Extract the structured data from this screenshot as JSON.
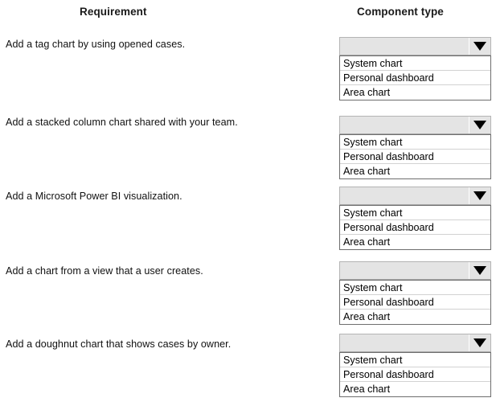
{
  "headers": {
    "requirement": "Requirement",
    "component_type": "Component type"
  },
  "dropdown_icon": "chevron-down-icon",
  "selected_value": "",
  "options": [
    "System chart",
    "Personal dashboard",
    "Area chart"
  ],
  "rows": [
    {
      "requirement": "Add a tag chart by using opened cases.",
      "selected": "",
      "options": [
        "System chart",
        "Personal dashboard",
        "Area chart"
      ]
    },
    {
      "requirement": "Add a stacked column chart shared with your team.",
      "selected": "",
      "options": [
        "System chart",
        "Personal dashboard",
        "Area chart"
      ]
    },
    {
      "requirement": "Add a Microsoft Power BI visualization.",
      "selected": "",
      "options": [
        "System chart",
        "Personal dashboard",
        "Area chart"
      ]
    },
    {
      "requirement": "Add a chart from a view that a user creates.",
      "selected": "",
      "options": [
        "System chart",
        "Personal dashboard",
        "Area chart"
      ]
    },
    {
      "requirement": "Add a doughnut chart that shows cases by owner.",
      "selected": "",
      "options": [
        "System chart",
        "Personal dashboard",
        "Area chart"
      ]
    }
  ],
  "colors": {
    "background": "#ffffff",
    "closed_box": "#e4e4e4",
    "list_border": "#6e6e6e",
    "option_separator": "#d2d2d2",
    "text": "#000000"
  }
}
